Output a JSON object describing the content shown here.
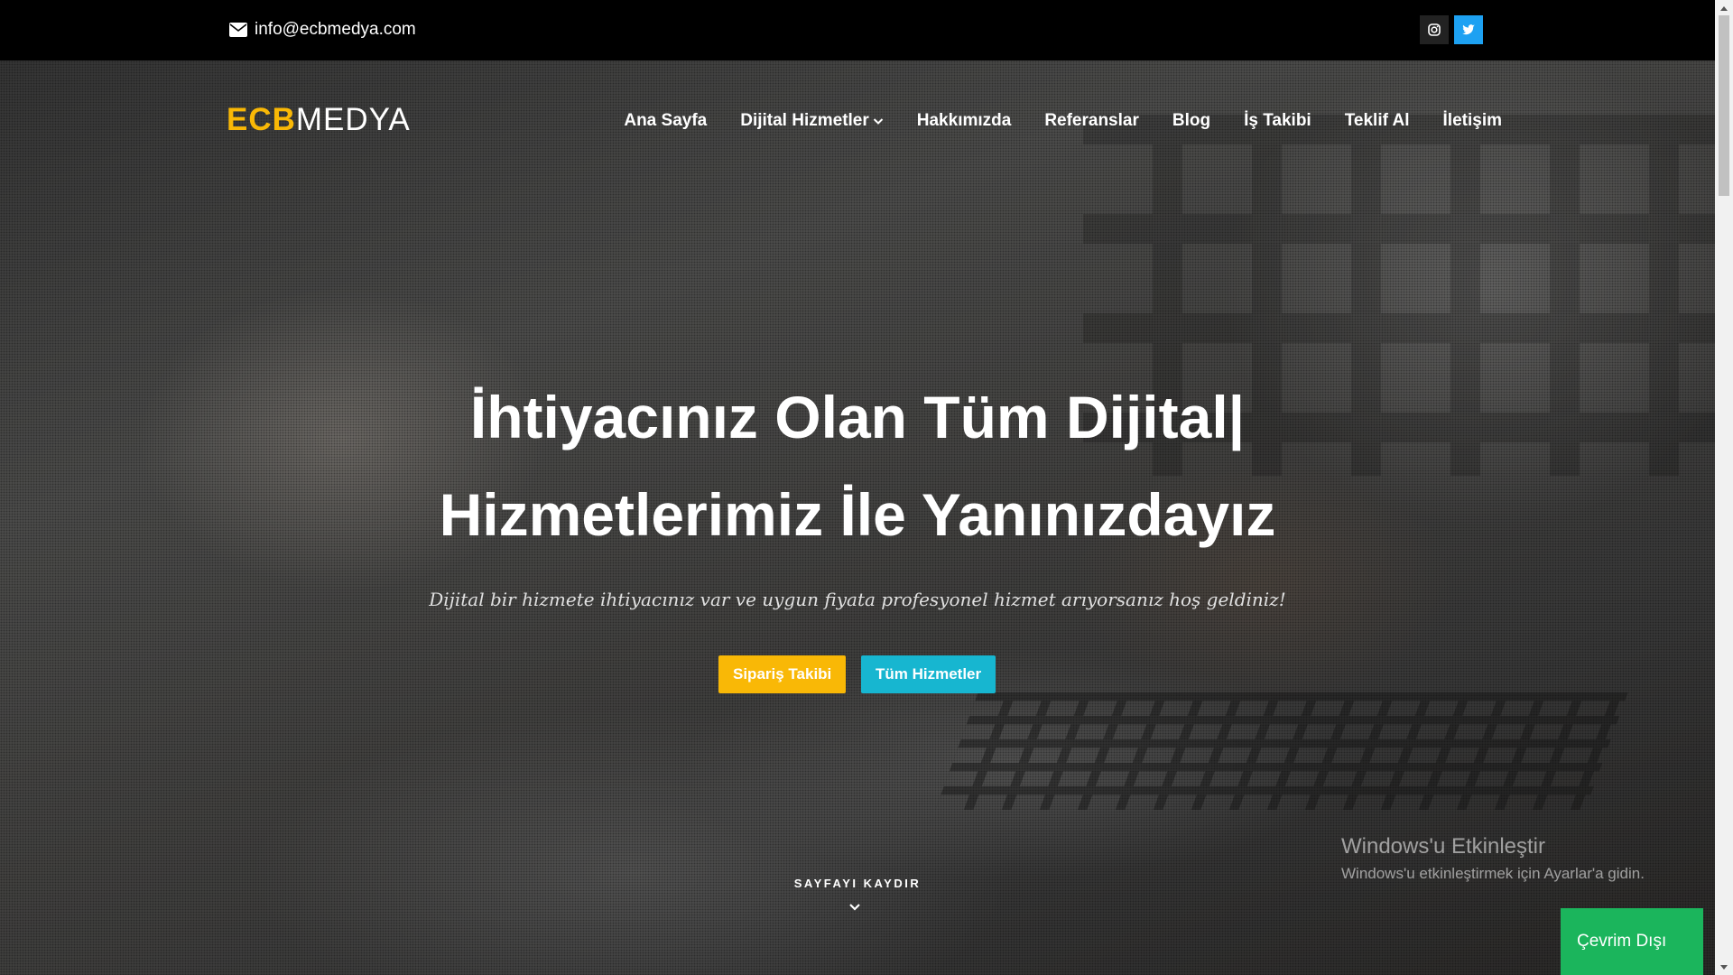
{
  "topbar": {
    "email": "info@ecbmedya.com",
    "email_icon": "envelope-icon",
    "social": [
      {
        "name": "instagram-icon",
        "color": "#222222"
      },
      {
        "name": "twitter-icon",
        "color": "#1da1f2"
      }
    ]
  },
  "header": {
    "logo_part1": "ECB",
    "logo_part2": "MEDYA",
    "nav": [
      "Ana Sayfa",
      "Dijital Hizmetler",
      "Hakkımızda",
      "Referanslar",
      "Blog",
      "İş Takibi",
      "Teklif Al",
      "İletişim"
    ]
  },
  "hero": {
    "headline_line1": "İhtiyacınız Olan Tüm Dijital|",
    "headline_line2": "Hizmetlerimiz İle Yanınızdayız",
    "subtitle": "Dijital bir hizmete ihtiyacınız var ve uygun fiyata profesyonel hizmet arıyorsanız hoş geldiniz!",
    "btn_order": "Sipariş Takibi",
    "btn_services": "Tüm Hizmetler",
    "scroll_label": "SAYFAYI KAYDIR"
  },
  "windows_notice": {
    "title": "Windows'u Etkinleştir",
    "text": "Windows'u etkinleştirmek için Ayarlar'a gidin."
  },
  "chat_widget": {
    "status": "Çevrim Dışı"
  },
  "colors": {
    "accent_yellow": "#f9b806",
    "accent_cyan": "#17b6d0",
    "offline_green": "#1bb55c"
  }
}
